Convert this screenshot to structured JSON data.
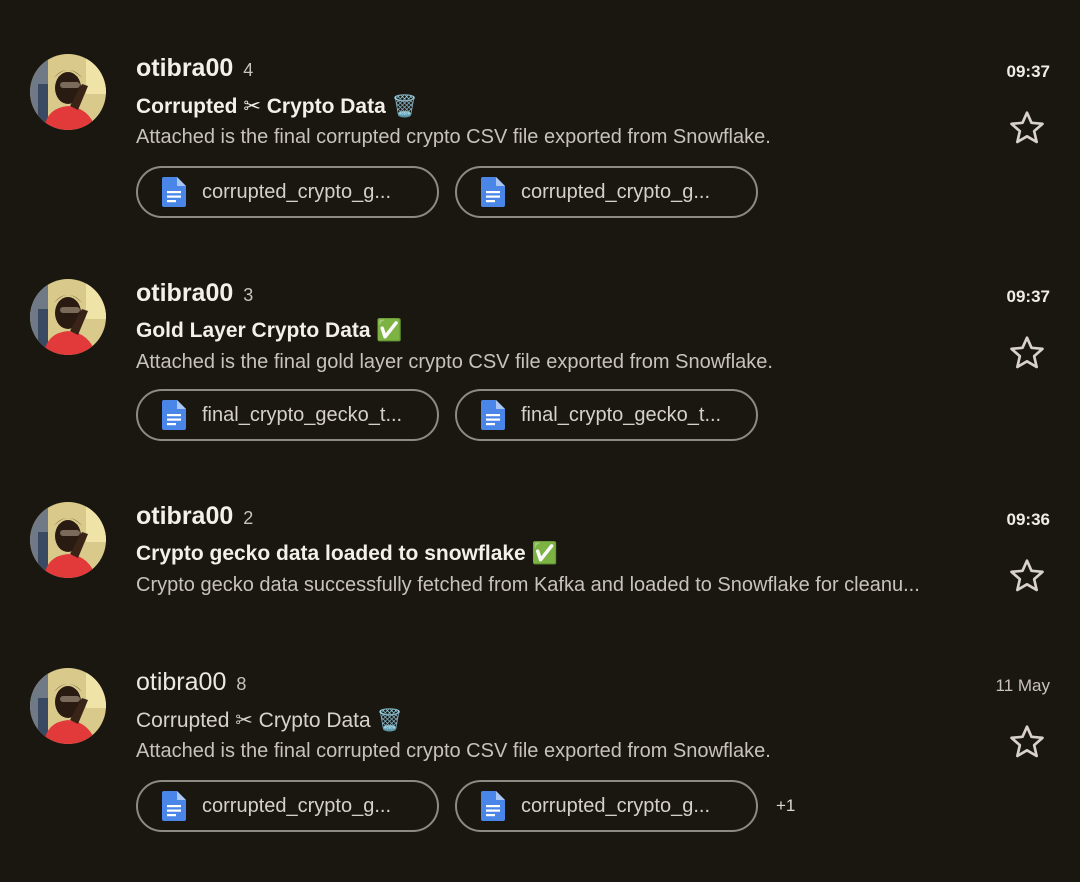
{
  "emails": [
    {
      "sender": "otibra00",
      "count": "4",
      "time": "09:37",
      "subject": "Corrupted ✂ Crypto Data 🗑️",
      "preview": "Attached is the final corrupted crypto CSV file exported from Snowflake.",
      "attachments": [
        "corrupted_crypto_g...",
        "corrupted_crypto_g..."
      ],
      "unread": true
    },
    {
      "sender": "otibra00",
      "count": "3",
      "time": "09:37",
      "subject": "Gold Layer Crypto Data ✅",
      "preview": "Attached is the final gold layer crypto CSV file exported from Snowflake.",
      "attachments": [
        "final_crypto_gecko_t...",
        "final_crypto_gecko_t..."
      ],
      "unread": true
    },
    {
      "sender": "otibra00",
      "count": "2",
      "time": "09:36",
      "subject": "Crypto gecko data loaded to snowflake ✅",
      "preview": "Crypto gecko data successfully fetched from Kafka and loaded to Snowflake for cleanu...",
      "attachments": [],
      "unread": true
    },
    {
      "sender": "otibra00",
      "count": "8",
      "time": "11 May",
      "subject": "Corrupted ✂ Crypto Data 🗑️",
      "preview": "Attached is the final corrupted crypto CSV file exported from Snowflake.",
      "attachments": [
        "corrupted_crypto_g...",
        "corrupted_crypto_g..."
      ],
      "more_attachments": "+1",
      "unread": false
    }
  ],
  "colors": {
    "background": "#1a1711",
    "file_icon": "#4a86e8",
    "chip_border": "#8e8a82",
    "avatar_shirt": "#e23a3a",
    "avatar_bg": "#d9c98a"
  },
  "icons": {
    "star": "star-outline-icon",
    "attachment": "google-docs-file-icon",
    "avatar": "user-photo-avatar"
  }
}
